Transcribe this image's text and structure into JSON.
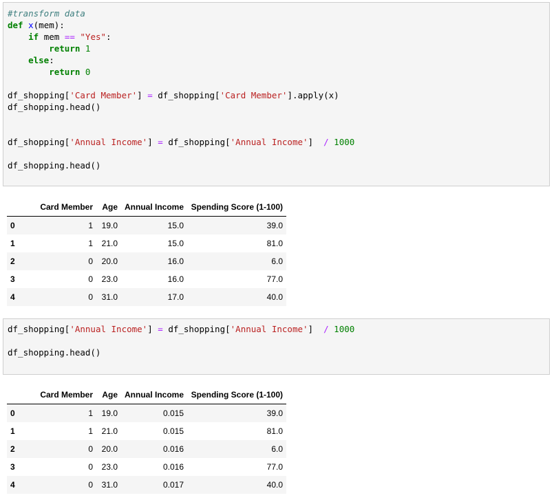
{
  "cell1": {
    "lines": [
      [
        {
          "t": "cm",
          "v": "#transform data"
        }
      ],
      [
        {
          "t": "kw",
          "v": "def"
        },
        {
          "t": "",
          "v": " "
        },
        {
          "t": "fn",
          "v": "x"
        },
        {
          "t": "",
          "v": "(mem):"
        }
      ],
      [
        {
          "t": "",
          "v": "    "
        },
        {
          "t": "kw",
          "v": "if"
        },
        {
          "t": "",
          "v": " mem "
        },
        {
          "t": "op",
          "v": "=="
        },
        {
          "t": "",
          "v": " "
        },
        {
          "t": "st",
          "v": "\"Yes\""
        },
        {
          "t": "",
          "v": ":"
        }
      ],
      [
        {
          "t": "",
          "v": "        "
        },
        {
          "t": "kw",
          "v": "return"
        },
        {
          "t": "",
          "v": " "
        },
        {
          "t": "nm",
          "v": "1"
        }
      ],
      [
        {
          "t": "",
          "v": "    "
        },
        {
          "t": "kw",
          "v": "else"
        },
        {
          "t": "",
          "v": ":"
        }
      ],
      [
        {
          "t": "",
          "v": "        "
        },
        {
          "t": "kw",
          "v": "return"
        },
        {
          "t": "",
          "v": " "
        },
        {
          "t": "nm",
          "v": "0"
        }
      ],
      [],
      [
        {
          "t": "",
          "v": "df_shopping["
        },
        {
          "t": "st",
          "v": "'Card Member'"
        },
        {
          "t": "",
          "v": "] "
        },
        {
          "t": "op",
          "v": "="
        },
        {
          "t": "",
          "v": " df_shopping["
        },
        {
          "t": "st",
          "v": "'Card Member'"
        },
        {
          "t": "",
          "v": "].apply(x)"
        }
      ],
      [
        {
          "t": "",
          "v": "df_shopping.head()"
        }
      ],
      [],
      [],
      [
        {
          "t": "",
          "v": "df_shopping["
        },
        {
          "t": "st",
          "v": "'Annual Income'"
        },
        {
          "t": "",
          "v": "] "
        },
        {
          "t": "op",
          "v": "="
        },
        {
          "t": "",
          "v": " df_shopping["
        },
        {
          "t": "st",
          "v": "'Annual Income'"
        },
        {
          "t": "",
          "v": "]  "
        },
        {
          "t": "op",
          "v": "/"
        },
        {
          "t": "",
          "v": " "
        },
        {
          "t": "nm",
          "v": "1000"
        }
      ],
      [],
      [
        {
          "t": "",
          "v": "df_shopping.head()"
        }
      ]
    ]
  },
  "table1": {
    "columns": [
      "Card Member",
      "Age",
      "Annual Income",
      "Spending Score (1-100)"
    ],
    "rows": [
      {
        "index": "0",
        "cells": [
          "1",
          "19.0",
          "15.0",
          "39.0"
        ]
      },
      {
        "index": "1",
        "cells": [
          "1",
          "21.0",
          "15.0",
          "81.0"
        ]
      },
      {
        "index": "2",
        "cells": [
          "0",
          "20.0",
          "16.0",
          "6.0"
        ]
      },
      {
        "index": "3",
        "cells": [
          "0",
          "23.0",
          "16.0",
          "77.0"
        ]
      },
      {
        "index": "4",
        "cells": [
          "0",
          "31.0",
          "17.0",
          "40.0"
        ]
      }
    ]
  },
  "cell2": {
    "lines": [
      [
        {
          "t": "",
          "v": "df_shopping["
        },
        {
          "t": "st",
          "v": "'Annual Income'"
        },
        {
          "t": "",
          "v": "] "
        },
        {
          "t": "op",
          "v": "="
        },
        {
          "t": "",
          "v": " df_shopping["
        },
        {
          "t": "st",
          "v": "'Annual Income'"
        },
        {
          "t": "",
          "v": "]  "
        },
        {
          "t": "op",
          "v": "/"
        },
        {
          "t": "",
          "v": " "
        },
        {
          "t": "nm",
          "v": "1000"
        }
      ],
      [],
      [
        {
          "t": "",
          "v": "df_shopping.head()"
        }
      ]
    ]
  },
  "table2": {
    "columns": [
      "Card Member",
      "Age",
      "Annual Income",
      "Spending Score (1-100)"
    ],
    "rows": [
      {
        "index": "0",
        "cells": [
          "1",
          "19.0",
          "0.015",
          "39.0"
        ]
      },
      {
        "index": "1",
        "cells": [
          "1",
          "21.0",
          "0.015",
          "81.0"
        ]
      },
      {
        "index": "2",
        "cells": [
          "0",
          "20.0",
          "0.016",
          "6.0"
        ]
      },
      {
        "index": "3",
        "cells": [
          "0",
          "23.0",
          "0.016",
          "77.0"
        ]
      },
      {
        "index": "4",
        "cells": [
          "0",
          "31.0",
          "0.017",
          "40.0"
        ]
      }
    ]
  }
}
